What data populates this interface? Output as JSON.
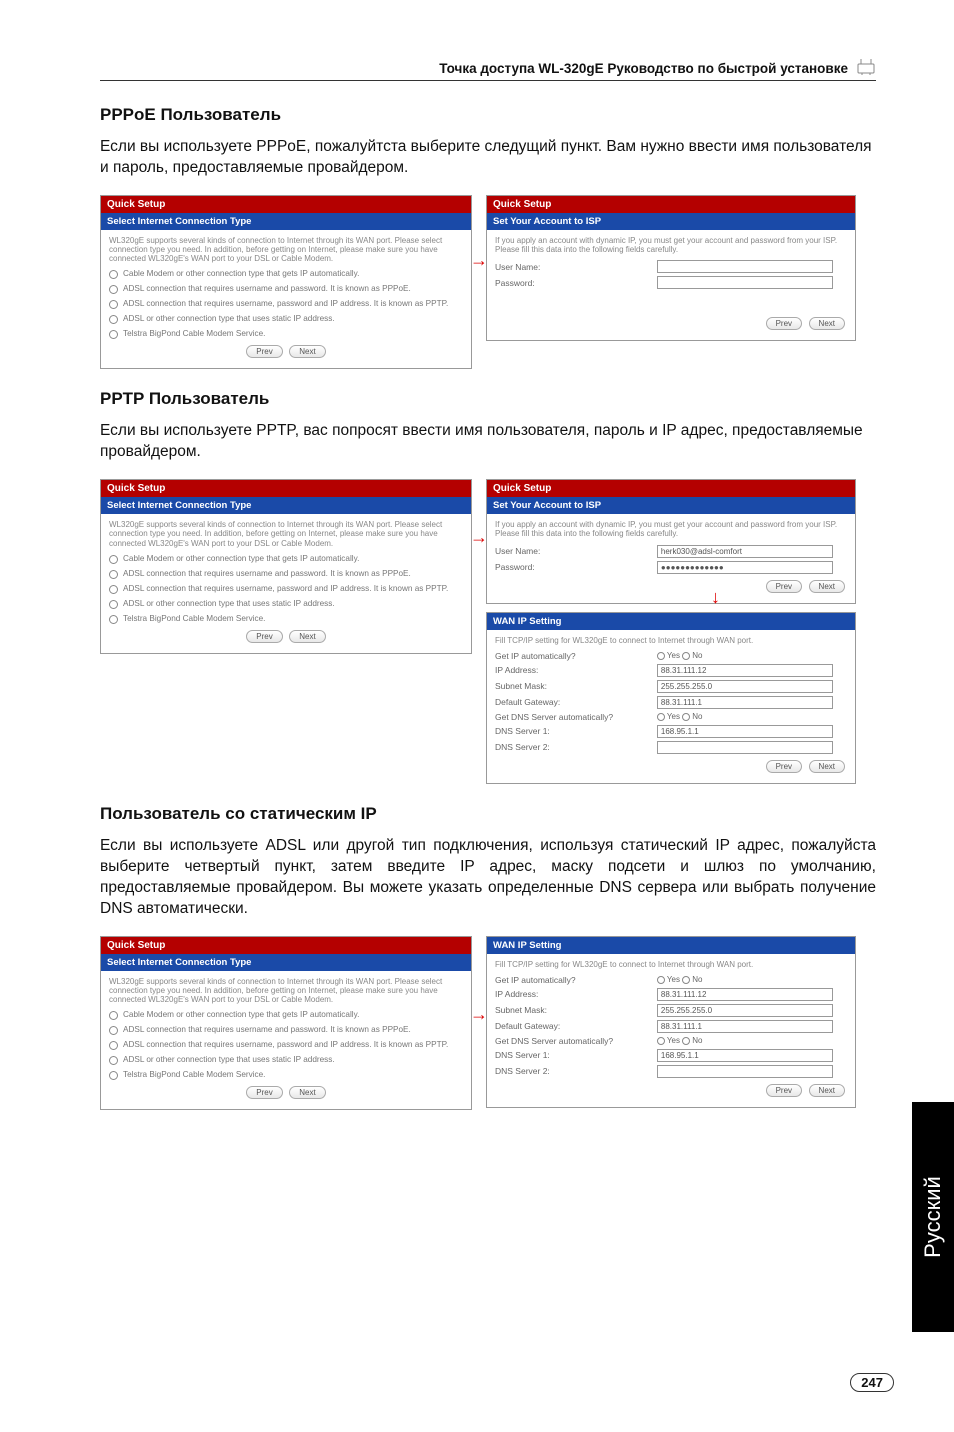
{
  "header": {
    "title": "Точка доступа WL-320gE Руководство по быстрой установке"
  },
  "side_tab": "Русский",
  "page_number": "247",
  "sections": [
    {
      "title": "PPPoE Пользователь",
      "text": "Если вы используете PPPoE, пожалуйтста выберите следущий пункт. Вам нужно ввести имя пользователя и пароль, предоставляемые провайдером."
    },
    {
      "title": "PPTP Пользователь",
      "text": "Если вы используете PPTP, вас попросят ввести  имя пользователя, пароль и IP адрес, предоставляемые провайдером."
    },
    {
      "title": "Пользователь со статическим IP",
      "text": "Если вы используете ADSL или другой тип подключения, используя статический IP адрес, пожалуйста выберите четвертый пункт, затем введите IP адрес, маску подсети и шлюз по умолчанию, предоставляемые провайдером. Вы можете указать определенные DNS сервера или выбрать получение DNS автоматически."
    }
  ],
  "quick_setup_panel": {
    "head": "Quick Setup",
    "bar": "Select Internet Connection Type",
    "intro": "WL320gE supports several kinds of connection to Internet through its WAN port. Please select connection type you need. In addition, before getting on Internet, please make sure you have connected WL320gE's WAN port to your DSL or Cable Modem.",
    "options": [
      "Cable Modem or other connection type that gets IP automatically.",
      "ADSL connection that requires username and password. It is known as PPPoE.",
      "ADSL connection that requires username, password and IP address. It is known as PPTP.",
      "ADSL or other connection type that uses static IP address.",
      "Telstra BigPond Cable Modem Service."
    ],
    "prev": "Prev",
    "next": "Next"
  },
  "isp_panel": {
    "head": "Quick Setup",
    "bar": "Set Your Account to ISP",
    "intro": "If you apply an account with dynamic IP, you must get your account and password from your ISP. Please fill this data into the following fields carefully.",
    "user_label": "User Name:",
    "pass_label": "Password:",
    "user2": "herk030@adsl-comfort",
    "pass2": "●●●●●●●●●●●●●",
    "prev": "Prev",
    "next": "Next"
  },
  "wan_panel": {
    "bar": "WAN IP Setting",
    "intro": "Fill TCP/IP setting for WL320gE to connect to Internet through WAN port.",
    "rows": {
      "get_ip": "Get IP automatically?",
      "ip": "IP Address:",
      "mask": "Subnet Mask:",
      "gw": "Default Gateway:",
      "dns_auto": "Get DNS Server automatically?",
      "dns1": "DNS Server 1:",
      "dns2": "DNS Server 2:"
    },
    "vals": {
      "ip": "88.31.111.12",
      "mask": "255.255.255.0",
      "gw": "88.31.111.1",
      "dns1": "168.95.1.1",
      "dns2": ""
    },
    "yes": "Yes",
    "no": "No",
    "prev": "Prev",
    "next": "Next"
  }
}
